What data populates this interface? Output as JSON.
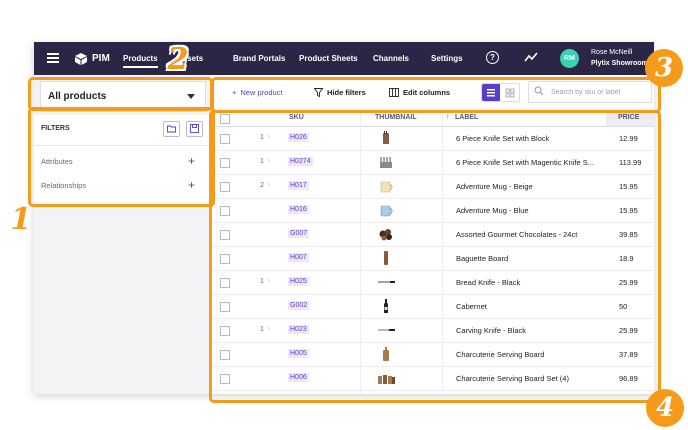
{
  "topbar": {
    "brand": "PIM",
    "nav": [
      {
        "label": "Products"
      },
      {
        "label": "Assets"
      },
      {
        "label": "Brand Portals"
      },
      {
        "label": "Product Sheets"
      },
      {
        "label": "Channels"
      },
      {
        "label": "Settings"
      }
    ],
    "user": {
      "initials": "RM",
      "name": "Rose McNeill",
      "company": "Plytix Showroom"
    }
  },
  "sidebar": {
    "catalog_select": "All products",
    "filters_title": "FILTERS",
    "rows": [
      {
        "label": "Attributes"
      },
      {
        "label": "Relationships"
      }
    ]
  },
  "toolbar": {
    "new_product": "New product",
    "hide_filters": "Hide filters",
    "edit_columns": "Edit columns",
    "search_placeholder": "Search by sku or label"
  },
  "grid": {
    "columns": {
      "sku": "SKU",
      "thumbnail": "THUMBNAIL",
      "label": "LABEL",
      "price": "PRICE"
    },
    "rows": [
      {
        "variants": "1",
        "sku": "H026",
        "thumb": "knife-block",
        "label": "6 Piece Knife Set with Block",
        "price": "12.99"
      },
      {
        "variants": "1",
        "sku": "H0274",
        "thumb": "knife-magnetic",
        "label": "6 Piece Knife Set with Magentic Knife S...",
        "price": "113.99"
      },
      {
        "variants": "2",
        "sku": "H017",
        "thumb": "mug-beige",
        "label": "Adventure Mug - Beige",
        "price": "15.95"
      },
      {
        "variants": "",
        "sku": "H016",
        "thumb": "mug-blue",
        "label": "Adventure Mug - Blue",
        "price": "15.95"
      },
      {
        "variants": "",
        "sku": "G007",
        "thumb": "chocolates",
        "label": "Assorted Gourmet Chocolates - 24ct",
        "price": "39.85"
      },
      {
        "variants": "",
        "sku": "H007",
        "thumb": "baguette-board",
        "label": "Baguette Board",
        "price": "18.9"
      },
      {
        "variants": "1",
        "sku": "H025",
        "thumb": "bread-knife",
        "label": "Bread Knife - Black",
        "price": "25.99"
      },
      {
        "variants": "",
        "sku": "G002",
        "thumb": "wine-bottle",
        "label": "Cabernet",
        "price": "50"
      },
      {
        "variants": "1",
        "sku": "H023",
        "thumb": "carving-knife",
        "label": "Carving Knife - Black",
        "price": "25.99"
      },
      {
        "variants": "",
        "sku": "H005",
        "thumb": "serving-board",
        "label": "Charcuterie Serving Board",
        "price": "37.89"
      },
      {
        "variants": "",
        "sku": "H006",
        "thumb": "serving-board-set",
        "label": "Charcuterie Serving Board Set (4)",
        "price": "96.89"
      }
    ]
  },
  "callouts": [
    "1",
    "2",
    "3",
    "4"
  ],
  "colors": {
    "topbar": "#2b2646",
    "accent": "#5b3ec7",
    "callout": "#f59a1b",
    "avatar": "#3ccfb0"
  }
}
